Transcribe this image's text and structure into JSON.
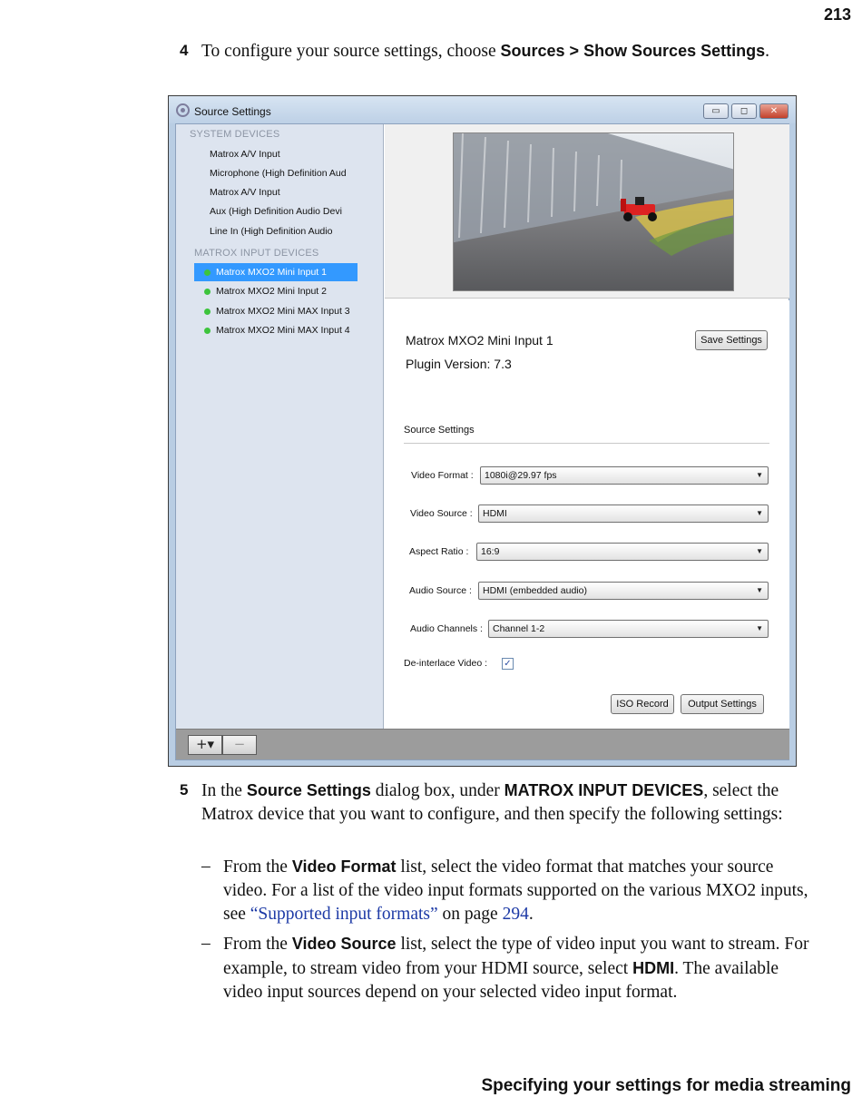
{
  "page": {
    "number": "213",
    "footer": "Specifying your settings for media streaming"
  },
  "step4": {
    "num": "4",
    "text_before": "To configure your source settings, choose ",
    "menu_path": "Sources > Show Sources Settings",
    "text_after": "."
  },
  "window": {
    "title": "Source Settings",
    "buttons": {
      "minimize": "▭",
      "maximize": "◻",
      "close": "✕"
    },
    "system_devices": {
      "header": "SYSTEM DEVICES",
      "items": [
        "Matrox A/V Input",
        "Microphone (High Definition Aud",
        "Matrox A/V  Input",
        "Aux (High Definition Audio Devi",
        "Line In (High Definition Audio"
      ]
    },
    "input_devices": {
      "header": "MATROX INPUT DEVICES",
      "items": [
        "Matrox MXO2 Mini Input 1",
        "Matrox MXO2 Mini Input 2",
        "Matrox MXO2 Mini MAX Input 3",
        "Matrox MXO2 Mini MAX Input 4"
      ],
      "selected_index": 0
    },
    "device_name": "Matrox MXO2 Mini Input 1",
    "plugin_version": "Plugin Version: 7.3",
    "save_button": "Save Settings",
    "group_label": "Source Settings",
    "fields": {
      "video_format": {
        "label": "Video Format :",
        "value": "1080i@29.97 fps"
      },
      "video_source": {
        "label": "Video Source :",
        "value": "HDMI"
      },
      "aspect_ratio": {
        "label": "Aspect Ratio :",
        "value": "16:9"
      },
      "audio_source": {
        "label": "Audio Source :",
        "value": "HDMI (embedded audio)"
      },
      "audio_channels": {
        "label": "Audio Channels :",
        "value": "Channel 1-2"
      },
      "deinterlace": {
        "label": "De-interlace Video :",
        "checked": true
      }
    },
    "iso_record_button": "ISO Record",
    "output_settings_button": "Output Settings",
    "toolbar": {
      "add": "+▾",
      "remove": "−"
    }
  },
  "step5": {
    "num": "5",
    "t1": "In the ",
    "b1": "Source Settings",
    "t2": " dialog box, under ",
    "b2": "MATROX INPUT DEVICES",
    "t3": ", select the Matrox device that you want to configure, and then specify the following settings:"
  },
  "bullets": {
    "dash": "–",
    "b1": {
      "t1": "From the ",
      "bold": "Video Format",
      "t2": " list, select the video format that matches your source video. For a list of the video input formats supported on the various MXO2 inputs, see ",
      "link": "“Supported input formats”",
      "t3": " on page ",
      "page_link": "294",
      "t4": "."
    },
    "b2": {
      "t1": "From the ",
      "bold": "Video Source",
      "t2": " list, select the type of video input you want to stream. For example, to stream video from your HDMI source, select ",
      "bold2": "HDMI",
      "t3": ". The available video input sources depend on your selected video input format."
    }
  }
}
